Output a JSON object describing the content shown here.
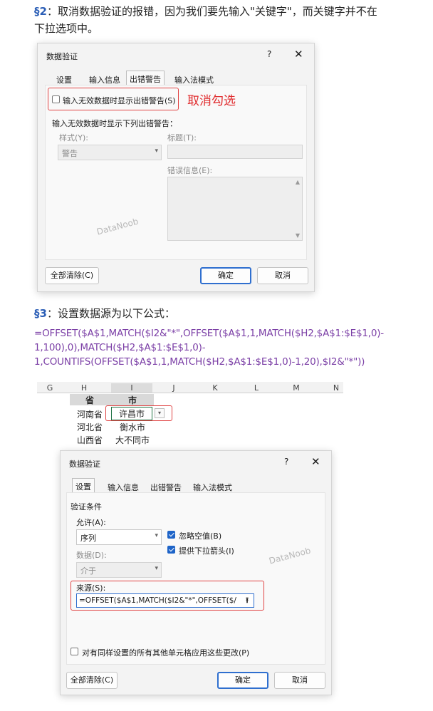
{
  "step2": {
    "prefix": "§2",
    "line1": "：取消数据验证的报错，因为我们要先输入\"关键字\"，而关键字并不在",
    "line2": "下拉选项中。"
  },
  "dialog1": {
    "title": "数据验证",
    "help": "?",
    "close": "✕",
    "tabs": [
      "设置",
      "输入信息",
      "出错警告",
      "输入法模式"
    ],
    "checkbox_label": "输入无效数据时显示出错警告(S)",
    "annotation": "取消勾选",
    "section_label": "输入无效数据时显示下列出错警告：",
    "style_label": "样式(Y):",
    "style_value": "警告",
    "title_label": "标题(T):",
    "error_label": "错误信息(E):",
    "watermark": "DataNoob",
    "clear_all": "全部清除(C)",
    "ok": "确定",
    "cancel": "取消"
  },
  "step3": {
    "prefix": "§3",
    "line1": "：设置数据源为以下公式：",
    "formula": [
      "=OFFSET($A$1,MATCH($I2&\"*\",OFFSET($A$1,1,MATCH($H2,$A$1:$E$1,0)-",
      "1,100),0),MATCH($H2,$A$1:$E$1,0)-",
      "1,COUNTIFS(OFFSET($A$1,1,MATCH($H2,$A$1:$E$1,0)-1,20),$I2&\"*\"))"
    ]
  },
  "sheet": {
    "columns": [
      "G",
      "H",
      "I",
      "J",
      "K",
      "L",
      "M",
      "N"
    ],
    "headers": [
      "省",
      "市"
    ],
    "rows": [
      [
        "河南省",
        "许昌市"
      ],
      [
        "河北省",
        "衡水市"
      ],
      [
        "山西省",
        "大不同市"
      ]
    ]
  },
  "dialog2": {
    "title": "数据验证",
    "help": "?",
    "close": "✕",
    "tabs": [
      "设置",
      "输入信息",
      "出错警告",
      "输入法模式"
    ],
    "section_label": "验证条件",
    "allow_label": "允许(A):",
    "allow_value": "序列",
    "ignore_blank": "忽略空值(B)",
    "dropdown_arrow": "提供下拉箭头(I)",
    "data_label": "数据(D):",
    "data_value": "介于",
    "source_label": "来源(S):",
    "source_value": "=OFFSET($A$1,MATCH($I2&\"*\",OFFSET($/",
    "apply_all": "对有同样设置的所有其他单元格应用这些更改(P)",
    "watermark": "DataNoob",
    "clear_all": "全部清除(C)",
    "ok": "确定",
    "cancel": "取消"
  }
}
